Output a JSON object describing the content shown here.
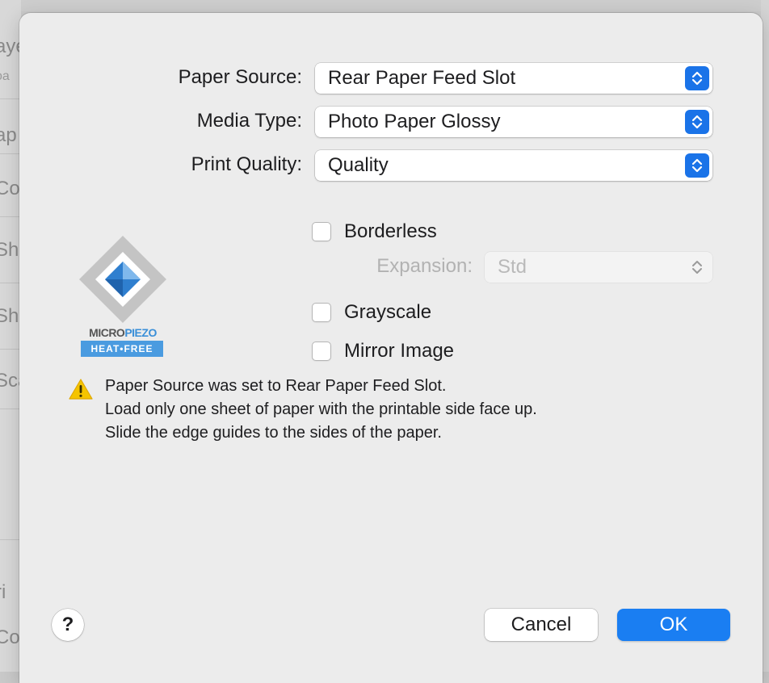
{
  "background": {
    "left_fragments": [
      "aye",
      "oa",
      "ap",
      "Co",
      "Sh",
      "Sh",
      "Sca",
      "ri",
      "Co"
    ]
  },
  "form": {
    "paper_source": {
      "label": "Paper Source:",
      "value": "Rear Paper Feed Slot"
    },
    "media_type": {
      "label": "Media Type:",
      "value": "Photo Paper Glossy"
    },
    "print_quality": {
      "label": "Print Quality:",
      "value": "Quality"
    },
    "borderless": {
      "label": "Borderless",
      "checked": false
    },
    "expansion": {
      "label": "Expansion:",
      "value": "Std",
      "disabled": true
    },
    "grayscale": {
      "label": "Grayscale",
      "checked": false
    },
    "mirror_image": {
      "label": "Mirror Image",
      "checked": false
    }
  },
  "logo": {
    "brand_a": "MICRO",
    "brand_b": "PIEZO",
    "tagline": "HEAT•FREE",
    "icon": "micro-piezo-logo"
  },
  "message": {
    "icon": "warning-icon",
    "lines": [
      "Paper Source was set to Rear Paper Feed Slot.",
      "Load only one sheet of paper with the printable side face up.",
      "Slide the edge guides to the sides of the paper."
    ]
  },
  "buttons": {
    "help": "?",
    "cancel": "Cancel",
    "ok": "OK"
  },
  "colors": {
    "accent": "#1a7ef2",
    "warning": "#f5c400"
  }
}
